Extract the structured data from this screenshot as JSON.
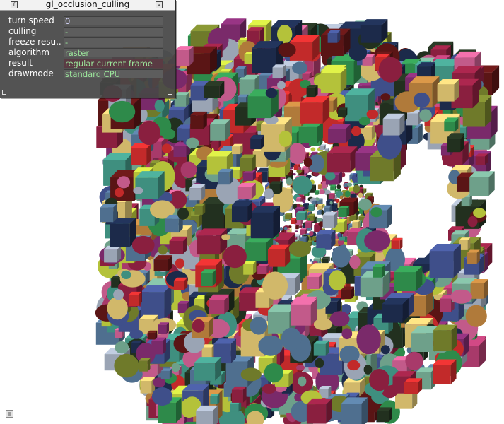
{
  "window": {
    "title": "gl_occlusion_culling"
  },
  "panel": {
    "rows": [
      {
        "label": "turn speed",
        "value": "0",
        "kind": "num"
      },
      {
        "label": "culling",
        "value": "-",
        "kind": "dash"
      },
      {
        "label": "freeze resu..",
        "value": "-",
        "kind": "dash"
      },
      {
        "label": "algorithm",
        "value": "raster",
        "kind": "opt"
      },
      {
        "label": "result",
        "value": "regular current frame",
        "kind": "opt-selected"
      },
      {
        "label": "drawmode",
        "value": "standard CPU",
        "kind": "opt"
      }
    ],
    "buttons": {
      "left_glyph": "f",
      "right_glyph": "v"
    }
  },
  "scene": {
    "description_colors": [
      "#8a1f3f",
      "#a83a6a",
      "#6f7a2a",
      "#b4c23a",
      "#2e8a4a",
      "#3f4f8a",
      "#4f6f8f",
      "#b07a3a",
      "#d1b86a",
      "#5a1515",
      "#c22a2a",
      "#3f8f7f",
      "#7a2a6a",
      "#c25a8a",
      "#22301f",
      "#1c2a4a",
      "#9aa4b4",
      "#6ea08a"
    ]
  }
}
